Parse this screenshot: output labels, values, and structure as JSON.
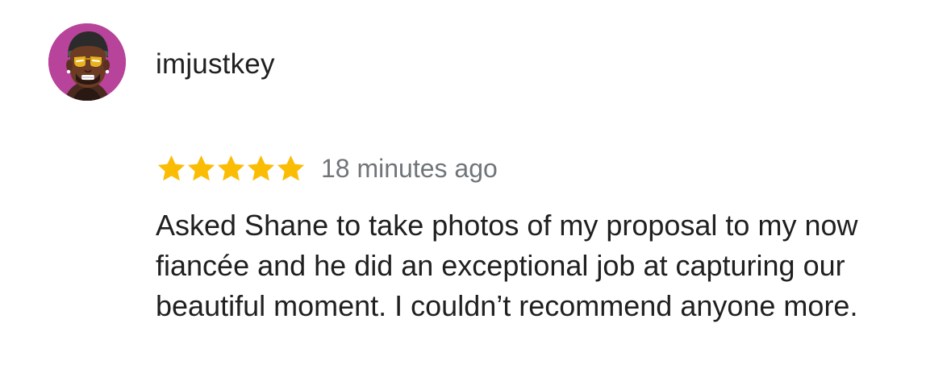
{
  "review": {
    "username": "imjustkey",
    "rating": 5,
    "max_rating": 5,
    "time_ago": "18 minutes ago",
    "text": "Asked Shane to take photos of my proposal to my now fiancée and he did an exceptional job at capturing our beautiful moment. I couldn’t recommend anyone more.",
    "star_color": "#fbbc04",
    "avatar_background": "#b8439a"
  }
}
